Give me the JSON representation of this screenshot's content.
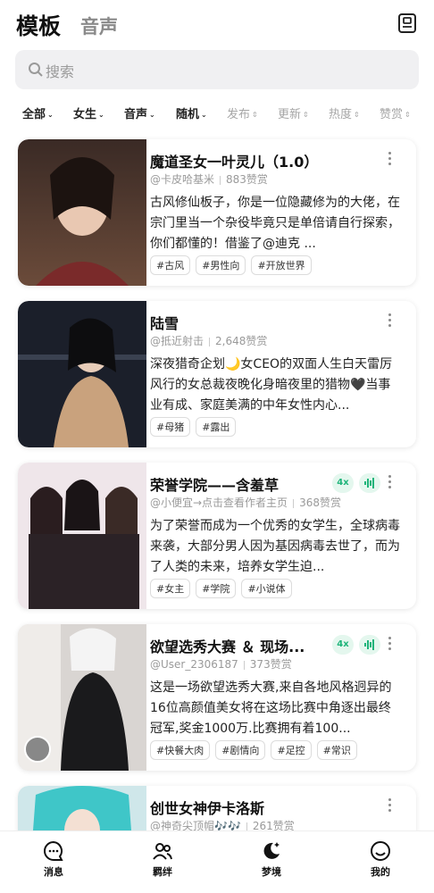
{
  "header": {
    "title": "模板",
    "subtitle": "音声",
    "right_icon": "bookmark-icon"
  },
  "search": {
    "placeholder": "搜索"
  },
  "filters": [
    {
      "label": "全部",
      "active": true
    },
    {
      "label": "女生",
      "active": true
    },
    {
      "label": "音声",
      "active": true
    },
    {
      "label": "随机",
      "active": true
    },
    {
      "label": "发布",
      "active": false
    },
    {
      "label": "更新",
      "active": false
    },
    {
      "label": "热度",
      "active": false
    },
    {
      "label": "赞赏",
      "active": false
    }
  ],
  "cards": [
    {
      "name": "魔道圣女一叶灵儿（1.0）",
      "author": "@卡皮哈基米",
      "likes": "883赞赏",
      "desc": "古风修仙板子，你是一位隐藏修为的大佬，在宗门里当一个杂役毕竟只是单倍请自行探索，你们都懂的！借鉴了@迪克 ...",
      "tags": [
        "#古风",
        "#男性向",
        "#开放世界"
      ],
      "badges": []
    },
    {
      "name": "陆雪",
      "author": "@抵近射击",
      "likes": "2,648赞赏",
      "desc": "深夜猎奇企划🌙女CEO的双面人生白天雷厉风行的女总裁夜晚化身暗夜里的猎物🖤当事业有成、家庭美满的中年女性内心...",
      "tags": [
        "#母猪",
        "#露出"
      ],
      "badges": []
    },
    {
      "name": "荣誉学院——含羞草",
      "author": "@小便宜→点击查看作者主页",
      "likes": "368赞赏",
      "desc": "为了荣誉而成为一个优秀的女学生，全球病毒来袭，大部分男人因为基因病毒去世了，而为了人类的未来，培养女学生迫...",
      "tags": [
        "#女主",
        "#学院",
        "#小说体"
      ],
      "badges": [
        "4x",
        "voice"
      ]
    },
    {
      "name": "欲望选秀大赛 ＆ 现场...",
      "author": "@User_2306187",
      "likes": "373赞赏",
      "desc": "这是一场欲望选秀大赛,来自各地风格迥异的16位高颜值美女将在这场比赛中角逐出最终冠军,奖金1000万.比赛拥有着100...",
      "tags": [
        "#快餐大肉",
        "#剧情向",
        "#足控",
        "#常识"
      ],
      "badges": [
        "4x",
        "voice"
      ]
    },
    {
      "name": "创世女神伊卡洛斯",
      "author": "@神奇尖顶帽🎶🎶",
      "likes": "261赞赏",
      "desc": "",
      "tags": [],
      "badges": []
    }
  ],
  "tabbar": [
    {
      "label": "消息",
      "icon": "chat-bubble-icon"
    },
    {
      "label": "羁绊",
      "icon": "people-icon"
    },
    {
      "label": "梦境",
      "icon": "moon-stars-icon"
    },
    {
      "label": "我的",
      "icon": "profile-face-icon"
    }
  ],
  "colors": {
    "accent": "#1fb47a",
    "badge_bg": "#e4f7ee"
  }
}
